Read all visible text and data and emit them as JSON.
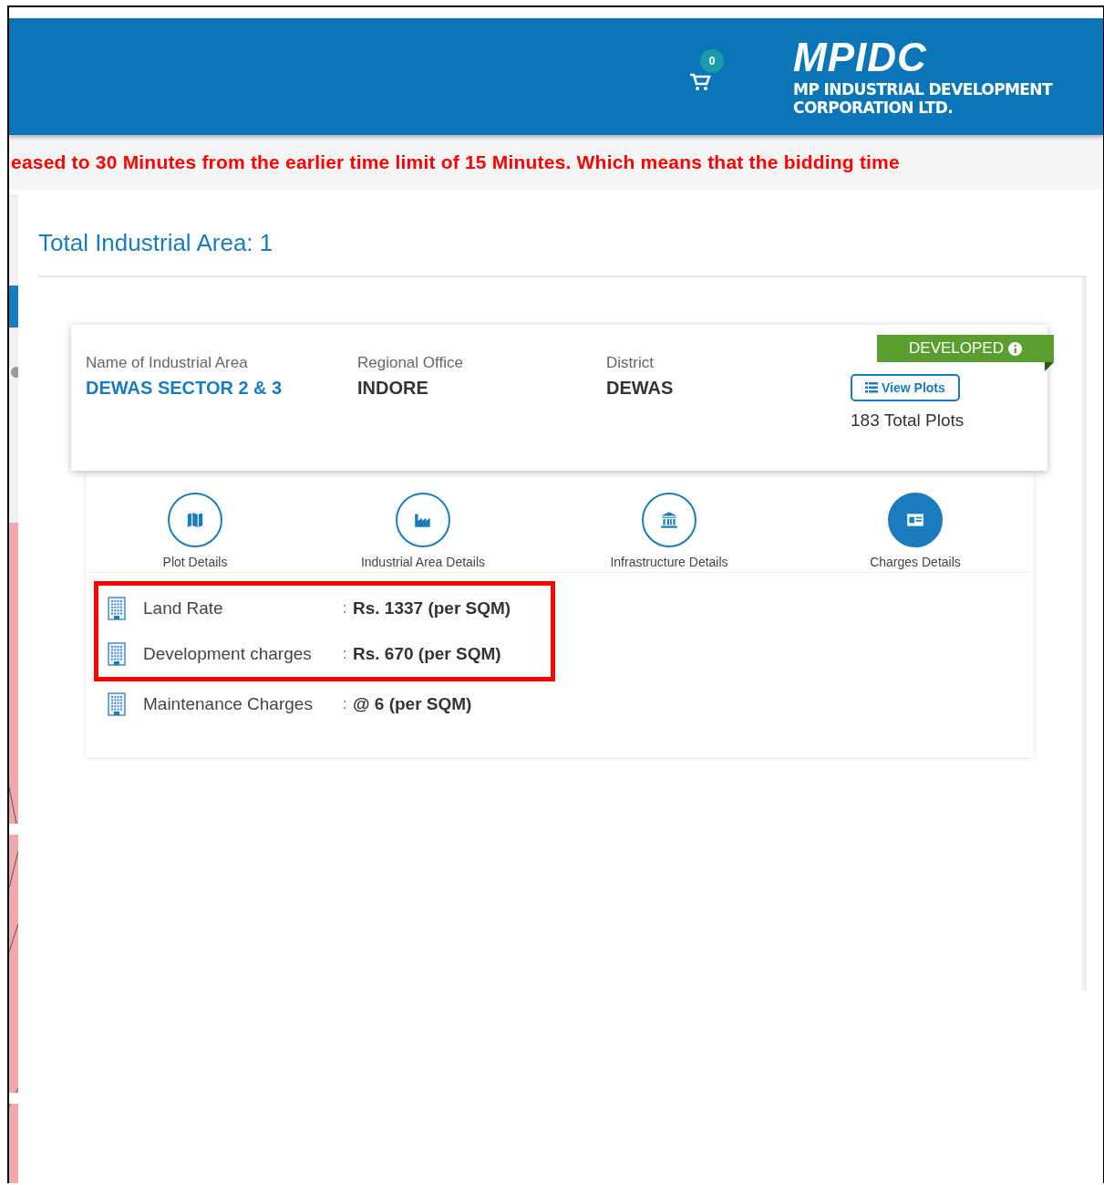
{
  "header": {
    "cart_count": "0",
    "logo_text": "MPIDC",
    "org_name": [
      "MP INDUSTRIAL DEVELOPMENT",
      "CORPORATION LTD."
    ]
  },
  "notice": "eased to 30 Minutes from the earlier time limit of 15 Minutes. Which means that the bidding time",
  "title": "Total Industrial Area: 1",
  "area_card": {
    "fields": [
      {
        "label": "Name of Industrial Area",
        "value": "DEWAS SECTOR 2 & 3",
        "kind": "link"
      },
      {
        "label": "Regional Office",
        "value": "INDORE",
        "kind": "text"
      },
      {
        "label": "District",
        "value": "DEWAS",
        "kind": "text"
      }
    ],
    "status": "DEVELOPED",
    "view_button": "View Plots",
    "total_plots": "183 Total Plots"
  },
  "tabs": [
    {
      "label": "Plot Details",
      "selected": false
    },
    {
      "label": "Industrial Area Details",
      "selected": false
    },
    {
      "label": "Infrastructure Details",
      "selected": false
    },
    {
      "label": "Charges Details",
      "selected": true
    }
  ],
  "charges": [
    {
      "name": "Land Rate",
      "separator": ":",
      "value": "Rs. 1337 (per SQM)",
      "highlighted": true
    },
    {
      "name": "Development charges",
      "separator": ":",
      "value": "Rs. 670 (per SQM)",
      "highlighted": true
    },
    {
      "name": "Maintenance Charges",
      "separator": ":",
      "value": "@ 6 (per SQM)",
      "highlighted": false
    }
  ]
}
